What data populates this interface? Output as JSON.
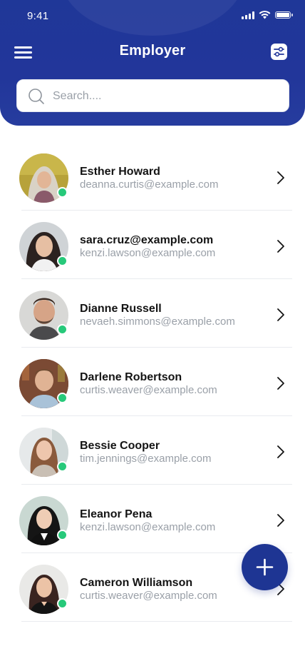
{
  "status_bar": {
    "time": "9:41",
    "icons": [
      "signal-icon",
      "wifi-icon",
      "battery-icon"
    ]
  },
  "header": {
    "title": "Employer",
    "menu_icon": "hamburger-menu-icon",
    "filter_icon": "filter-sliders-icon",
    "background_color": "#22369a"
  },
  "search": {
    "placeholder": "Search....",
    "value": "",
    "icon": "search-icon"
  },
  "employees": [
    {
      "name": "Esther Howard",
      "email": "deanna.curtis@example.com",
      "online": true
    },
    {
      "name": "sara.cruz@example.com",
      "email": "kenzi.lawson@example.com",
      "online": true
    },
    {
      "name": "Dianne Russell",
      "email": "nevaeh.simmons@example.com",
      "online": true
    },
    {
      "name": "Darlene Robertson",
      "email": "curtis.weaver@example.com",
      "online": true
    },
    {
      "name": "Bessie Cooper",
      "email": "tim.jennings@example.com",
      "online": true
    },
    {
      "name": "Eleanor Pena",
      "email": "kenzi.lawson@example.com",
      "online": true
    },
    {
      "name": "Cameron Williamson",
      "email": "curtis.weaver@example.com",
      "online": true
    }
  ],
  "fab": {
    "icon": "plus-icon"
  },
  "colors": {
    "primary": "#1e3593",
    "online": "#27c97a",
    "secondary_text": "#9aa0a8"
  }
}
